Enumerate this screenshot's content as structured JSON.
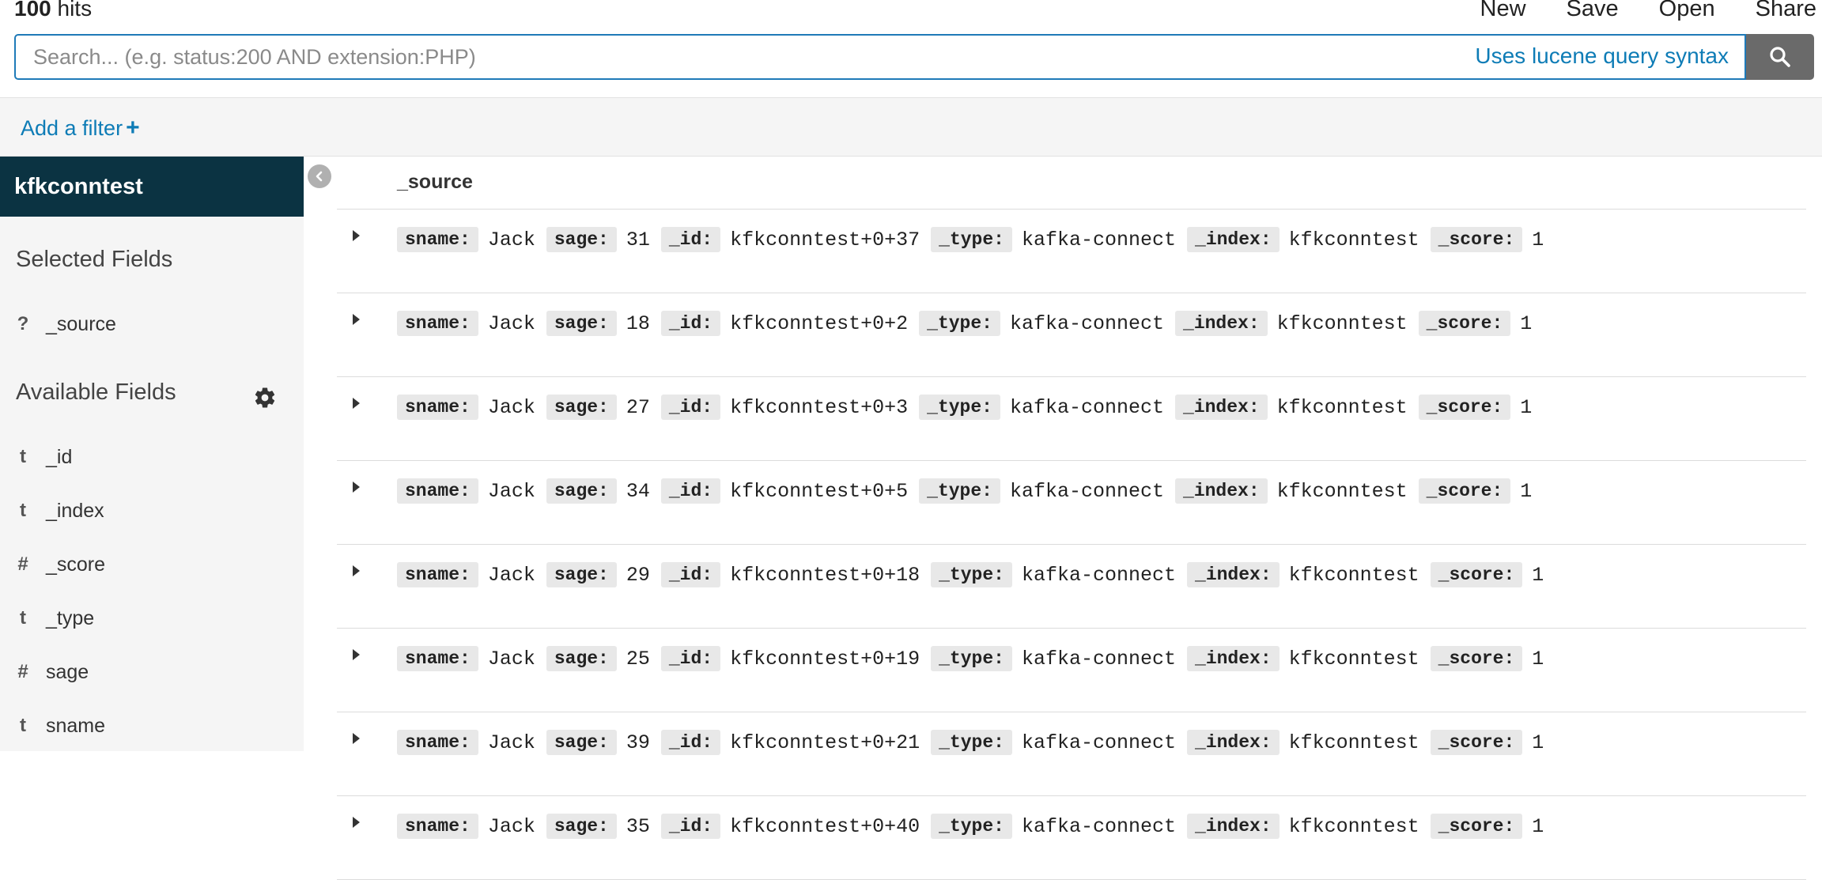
{
  "hits": {
    "count": "100",
    "label": "hits"
  },
  "menu": [
    "New",
    "Save",
    "Open",
    "Share"
  ],
  "search": {
    "placeholder": "Search... (e.g. status:200 AND extension:PHP)",
    "syntax_link": "Uses lucene query syntax"
  },
  "filter": {
    "add_label": "Add a filter",
    "plus": "+"
  },
  "sidebar": {
    "index_name": "kfkconntest",
    "selected_title": "Selected Fields",
    "selected_fields": [
      {
        "type": "?",
        "name": "_source"
      }
    ],
    "available_title": "Available Fields",
    "available_fields": [
      {
        "type": "t",
        "name": "_id"
      },
      {
        "type": "t",
        "name": "_index"
      },
      {
        "type": "#",
        "name": "_score"
      },
      {
        "type": "t",
        "name": "_type"
      },
      {
        "type": "#",
        "name": "sage"
      },
      {
        "type": "t",
        "name": "sname"
      }
    ]
  },
  "table": {
    "column": "_source",
    "keys": {
      "sname": "sname:",
      "sage": "sage:",
      "id": "_id:",
      "type": "_type:",
      "index": "_index:",
      "score": "_score:"
    },
    "rows": [
      {
        "sname": "Jack",
        "sage": "31",
        "id": "kfkconntest+0+37",
        "type": "kafka-connect",
        "index": "kfkconntest",
        "score": "1"
      },
      {
        "sname": "Jack",
        "sage": "18",
        "id": "kfkconntest+0+2",
        "type": "kafka-connect",
        "index": "kfkconntest",
        "score": "1"
      },
      {
        "sname": "Jack",
        "sage": "27",
        "id": "kfkconntest+0+3",
        "type": "kafka-connect",
        "index": "kfkconntest",
        "score": "1"
      },
      {
        "sname": "Jack",
        "sage": "34",
        "id": "kfkconntest+0+5",
        "type": "kafka-connect",
        "index": "kfkconntest",
        "score": "1"
      },
      {
        "sname": "Jack",
        "sage": "29",
        "id": "kfkconntest+0+18",
        "type": "kafka-connect",
        "index": "kfkconntest",
        "score": "1"
      },
      {
        "sname": "Jack",
        "sage": "25",
        "id": "kfkconntest+0+19",
        "type": "kafka-connect",
        "index": "kfkconntest",
        "score": "1"
      },
      {
        "sname": "Jack",
        "sage": "39",
        "id": "kfkconntest+0+21",
        "type": "kafka-connect",
        "index": "kfkconntest",
        "score": "1"
      },
      {
        "sname": "Jack",
        "sage": "35",
        "id": "kfkconntest+0+40",
        "type": "kafka-connect",
        "index": "kfkconntest",
        "score": "1"
      }
    ]
  },
  "colors": {
    "accent": "#0e7cb6",
    "sidebar_header": "#0b3342",
    "search_button": "#6a6a6a"
  }
}
